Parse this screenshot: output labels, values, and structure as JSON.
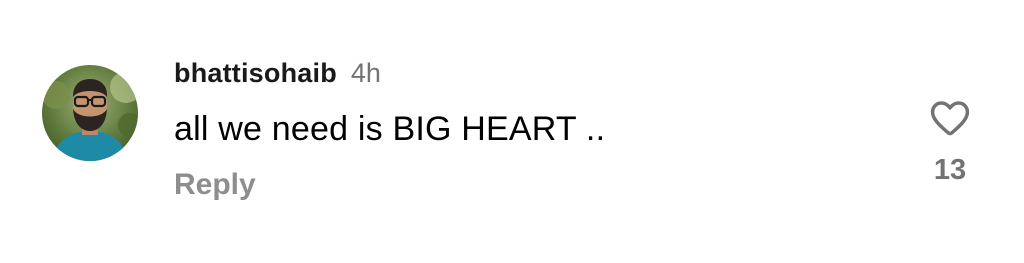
{
  "comment": {
    "username": "bhattisohaib",
    "time_ago": "4h",
    "text": "all we need is BIG HEART ..",
    "reply_label": "Reply",
    "like_count": "13",
    "like_icon": "heart-outline-icon"
  },
  "colors": {
    "username": "#1a1a1a",
    "secondary_text": "#737373",
    "reply": "#8e8e8e",
    "heart_stroke": "#737373"
  }
}
